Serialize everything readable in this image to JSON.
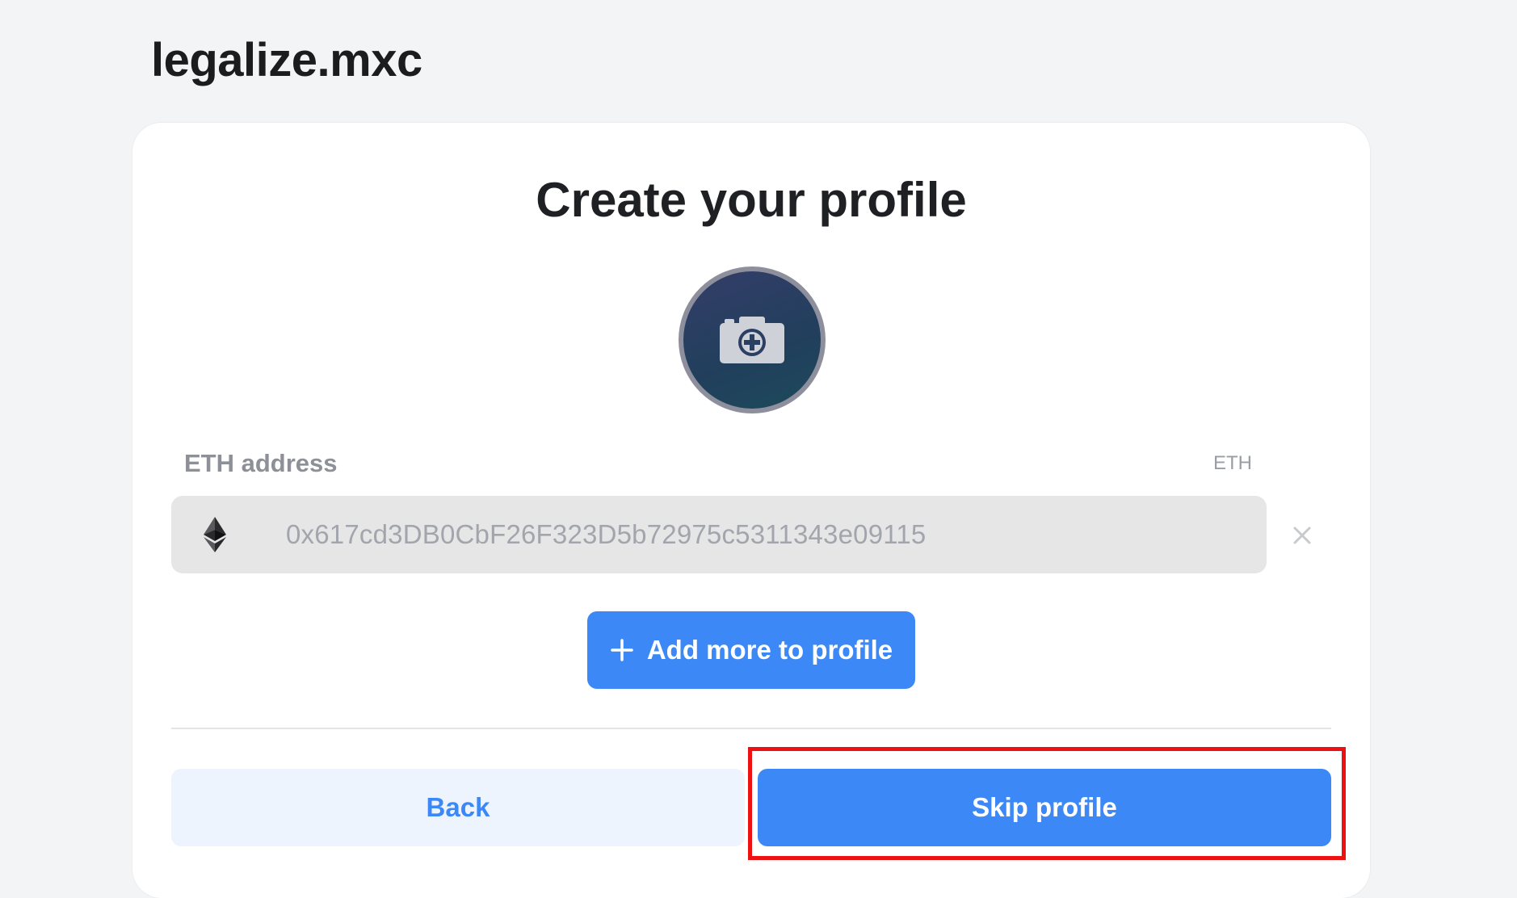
{
  "header": {
    "site_title": "legalize.mxc"
  },
  "profile_card": {
    "title": "Create your profile",
    "avatar_icon": "camera-plus-icon",
    "eth_field": {
      "label": "ETH address",
      "tag": "ETH",
      "value": "0x617cd3DB0CbF26F323D5b72975c5311343e09115",
      "icon": "ethereum-icon"
    },
    "add_more_label": "Add more to profile",
    "back_label": "Back",
    "skip_label": "Skip profile"
  },
  "colors": {
    "accent": "#3b88f6",
    "highlight": "#ee1111"
  }
}
